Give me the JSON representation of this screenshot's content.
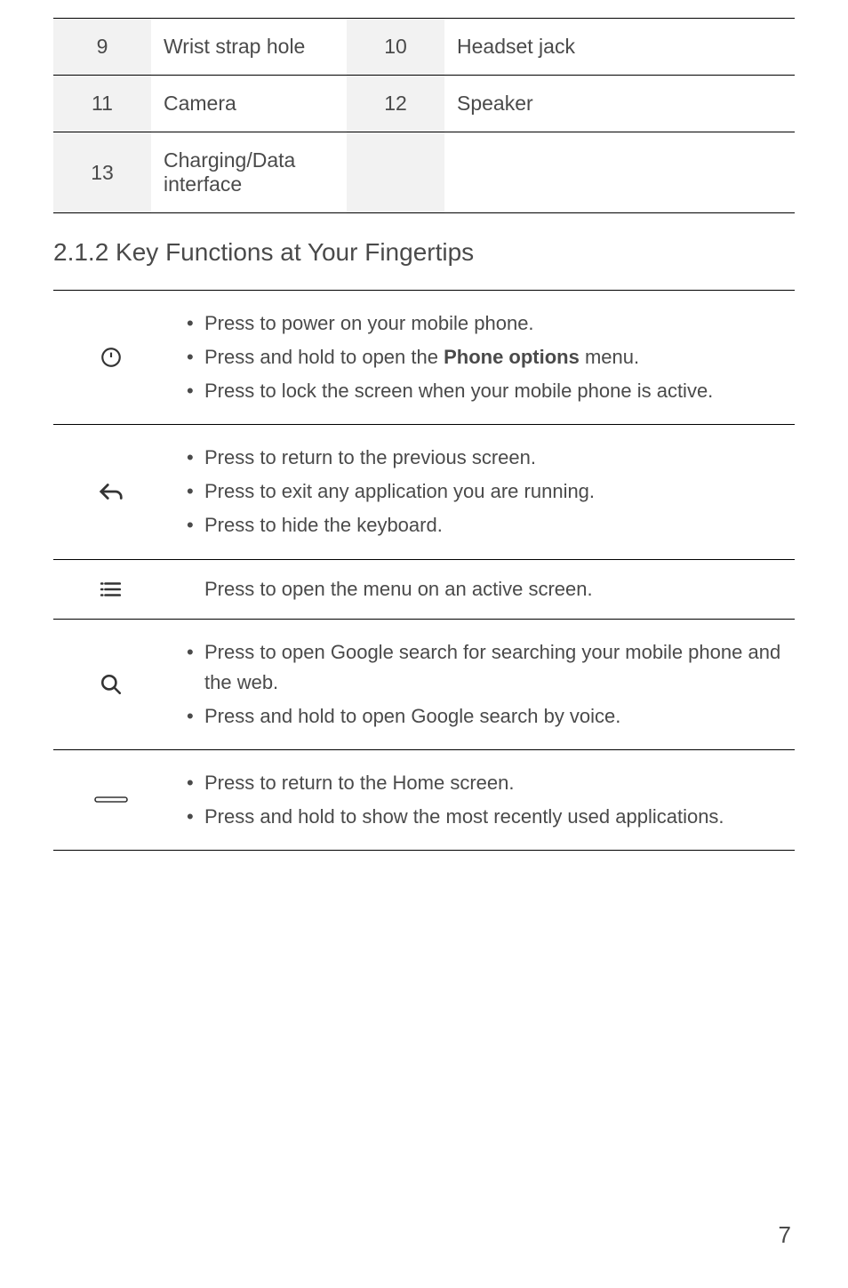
{
  "specs": {
    "rows": [
      {
        "num1": "9",
        "label1": "Wrist strap hole",
        "num2": "10",
        "label2": "Headset jack"
      },
      {
        "num1": "11",
        "label1": "Camera",
        "num2": "12",
        "label2": "Speaker"
      },
      {
        "num1": "13",
        "label1": "Charging/Data interface",
        "num2": "",
        "label2": ""
      }
    ]
  },
  "heading": "2.1.2  Key Functions at Your Fingertips",
  "functions": [
    {
      "icon": "power-icon",
      "items": [
        {
          "text": "Press to power on your mobile phone."
        },
        {
          "pre": "Press and hold to open the ",
          "bold": "Phone options",
          "post": " menu."
        },
        {
          "text": "Press to lock the screen when your mobile phone is active."
        }
      ]
    },
    {
      "icon": "back-icon",
      "items": [
        {
          "text": "Press to return to the previous screen."
        },
        {
          "text": "Press to exit any application you are running."
        },
        {
          "text": "Press to hide the keyboard."
        }
      ]
    },
    {
      "icon": "menu-icon",
      "plain": "Press to open the menu on an active screen."
    },
    {
      "icon": "search-icon",
      "items": [
        {
          "text": "Press to open Google search for searching your mobile phone and the web."
        },
        {
          "text": "Press and hold to open Google search by voice."
        }
      ]
    },
    {
      "icon": "home-icon",
      "items": [
        {
          "text": "Press to return to the Home screen."
        },
        {
          "text": "Press and hold to show the most recently used applications."
        }
      ]
    }
  ],
  "page_number": "7"
}
